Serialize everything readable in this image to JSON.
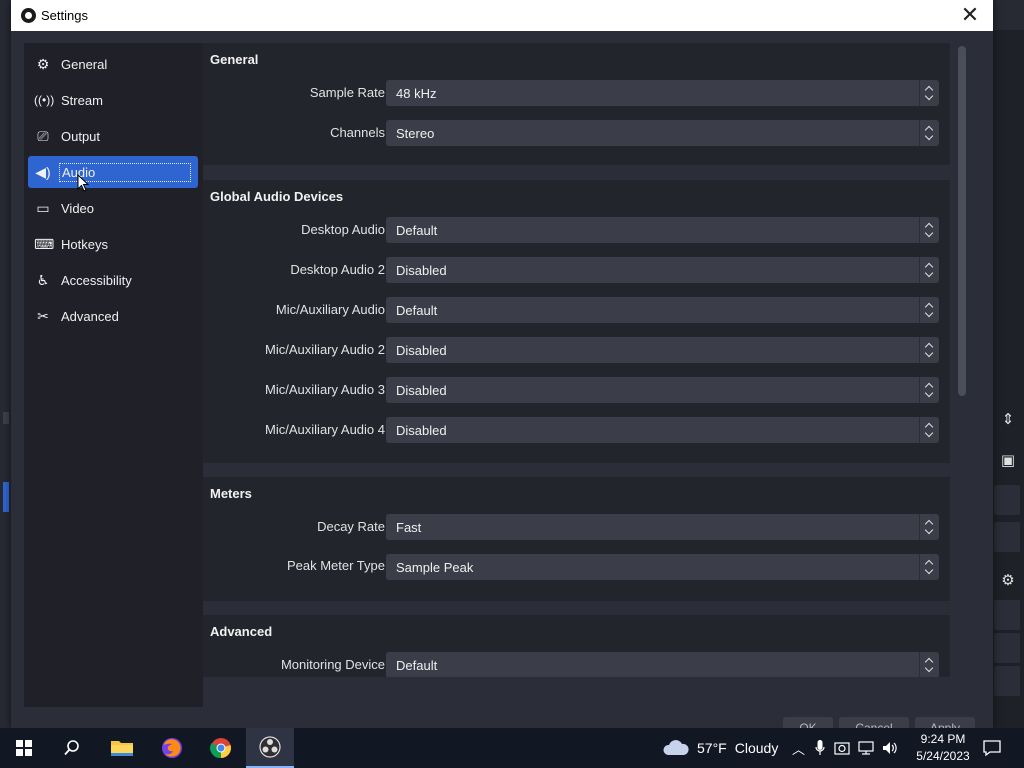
{
  "dialog": {
    "title": "Settings",
    "close_symbol": "✕"
  },
  "sidebar": {
    "items": [
      {
        "label": "General",
        "icon": "gear-icon",
        "glyph": "⚙"
      },
      {
        "label": "Stream",
        "icon": "antenna-icon",
        "glyph": "📡"
      },
      {
        "label": "Output",
        "icon": "output-icon",
        "glyph": "⎚"
      },
      {
        "label": "Audio",
        "icon": "speaker-icon",
        "glyph": "🔊",
        "active": true
      },
      {
        "label": "Video",
        "icon": "monitor-icon",
        "glyph": "▭"
      },
      {
        "label": "Hotkeys",
        "icon": "keyboard-icon",
        "glyph": "⌨"
      },
      {
        "label": "Accessibility",
        "icon": "accessibility-icon",
        "glyph": "♿"
      },
      {
        "label": "Advanced",
        "icon": "tools-icon",
        "glyph": "✂"
      }
    ]
  },
  "sections": {
    "general": {
      "title": "General",
      "rows": [
        {
          "label": "Sample Rate",
          "value": "48 kHz"
        },
        {
          "label": "Channels",
          "value": "Stereo"
        }
      ]
    },
    "global_audio": {
      "title": "Global Audio Devices",
      "rows": [
        {
          "label": "Desktop Audio",
          "value": "Default"
        },
        {
          "label": "Desktop Audio 2",
          "value": "Disabled"
        },
        {
          "label": "Mic/Auxiliary Audio",
          "value": "Default"
        },
        {
          "label": "Mic/Auxiliary Audio 2",
          "value": "Disabled"
        },
        {
          "label": "Mic/Auxiliary Audio 3",
          "value": "Disabled"
        },
        {
          "label": "Mic/Auxiliary Audio 4",
          "value": "Disabled"
        }
      ]
    },
    "meters": {
      "title": "Meters",
      "rows": [
        {
          "label": "Decay Rate",
          "value": "Fast"
        },
        {
          "label": "Peak Meter Type",
          "value": "Sample Peak"
        }
      ]
    },
    "advanced": {
      "title": "Advanced",
      "rows": [
        {
          "label": "Monitoring Device",
          "value": "Default"
        }
      ]
    }
  },
  "dialog_buttons": {
    "ok": "OK",
    "cancel": "Cancel",
    "apply": "Apply"
  },
  "taskbar": {
    "weather": {
      "temp": "57°F",
      "condition": "Cloudy"
    },
    "time": "9:24 PM",
    "date": "5/24/2023"
  },
  "colors": {
    "accent": "#2f65d1",
    "panel": "#23252d",
    "dialog": "#2b2e38",
    "combo": "#3b3e48",
    "taskbar": "#121724"
  }
}
